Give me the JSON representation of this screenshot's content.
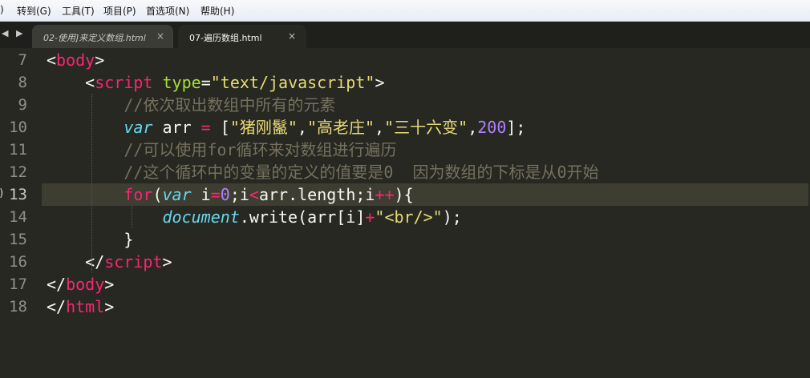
{
  "menu": [
    {
      "label": ")"
    },
    {
      "label": "转到(G)"
    },
    {
      "label": "工具(T)"
    },
    {
      "label": "项目(P)"
    },
    {
      "label": "首选项(N)"
    },
    {
      "label": "帮助(H)"
    }
  ],
  "tabbar": {
    "nav_arrows": "◀ ▶",
    "tabs": [
      {
        "label": "02-使用]来定义数组.html",
        "close": "×",
        "active": false
      },
      {
        "label": "07-遍历数组.html",
        "close": "×",
        "active": true
      }
    ]
  },
  "editor": {
    "line_numbers": [
      "7",
      "8",
      "9",
      "10",
      "11",
      "12",
      "13",
      "14",
      "15",
      "16",
      "17",
      "18"
    ],
    "current_line_index": 6,
    "gutter_mark": ")",
    "colors": {
      "background": "#272822",
      "tag": "#f92672",
      "attribute": "#a6e22e",
      "string": "#e6db74",
      "comment": "#75715e",
      "keyword": "#66d9ef",
      "number": "#ae81ff"
    },
    "lines": [
      [
        {
          "t": "<",
          "c": "pl"
        },
        {
          "t": "body",
          "c": "tag"
        },
        {
          "t": ">",
          "c": "pl"
        }
      ],
      [
        {
          "t": "    <",
          "c": "pl"
        },
        {
          "t": "script",
          "c": "tag"
        },
        {
          "t": " ",
          "c": "pl"
        },
        {
          "t": "type",
          "c": "attr"
        },
        {
          "t": "=",
          "c": "pl"
        },
        {
          "t": "\"text/javascript\"",
          "c": "str"
        },
        {
          "t": ">",
          "c": "pl"
        }
      ],
      [
        {
          "t": "        //依次取出数组中所有的元素",
          "c": "cmt"
        }
      ],
      [
        {
          "t": "        ",
          "c": "pl"
        },
        {
          "t": "var",
          "c": "kw"
        },
        {
          "t": " arr ",
          "c": "pl"
        },
        {
          "t": "=",
          "c": "op"
        },
        {
          "t": " [",
          "c": "pl"
        },
        {
          "t": "\"猪刚鬣\"",
          "c": "str"
        },
        {
          "t": ",",
          "c": "pl"
        },
        {
          "t": "\"高老庄\"",
          "c": "str"
        },
        {
          "t": ",",
          "c": "pl"
        },
        {
          "t": "\"三十六变\"",
          "c": "str"
        },
        {
          "t": ",",
          "c": "pl"
        },
        {
          "t": "200",
          "c": "num"
        },
        {
          "t": "];",
          "c": "pl"
        }
      ],
      [
        {
          "t": "        //可以使用for循环来对数组进行遍历",
          "c": "cmt"
        }
      ],
      [
        {
          "t": "        //这个循环中的变量的定义的值要是0  因为数组的下标是从0开始",
          "c": "cmt"
        }
      ],
      [
        {
          "t": "        ",
          "c": "pl"
        },
        {
          "t": "for",
          "c": "tag"
        },
        {
          "t": "(",
          "c": "pl"
        },
        {
          "t": "var",
          "c": "kw"
        },
        {
          "t": " i",
          "c": "pl"
        },
        {
          "t": "=",
          "c": "op"
        },
        {
          "t": "0",
          "c": "num"
        },
        {
          "t": ";i",
          "c": "pl"
        },
        {
          "t": "<",
          "c": "op"
        },
        {
          "t": "arr.length;i",
          "c": "pl"
        },
        {
          "t": "++",
          "c": "op"
        },
        {
          "t": "){",
          "c": "pl"
        }
      ],
      [
        {
          "t": "            ",
          "c": "pl"
        },
        {
          "t": "document",
          "c": "sup"
        },
        {
          "t": ".write(arr[i]",
          "c": "pl"
        },
        {
          "t": "+",
          "c": "op"
        },
        {
          "t": "\"<br/>\"",
          "c": "str"
        },
        {
          "t": ");",
          "c": "pl"
        }
      ],
      [
        {
          "t": "        }",
          "c": "pl"
        }
      ],
      [
        {
          "t": "    </",
          "c": "pl"
        },
        {
          "t": "script",
          "c": "tag"
        },
        {
          "t": ">",
          "c": "pl"
        }
      ],
      [
        {
          "t": "</",
          "c": "pl"
        },
        {
          "t": "body",
          "c": "tag"
        },
        {
          "t": ">",
          "c": "pl"
        }
      ],
      [
        {
          "t": "</",
          "c": "pl"
        },
        {
          "t": "html",
          "c": "tag"
        },
        {
          "t": ">",
          "c": "pl"
        }
      ]
    ]
  }
}
